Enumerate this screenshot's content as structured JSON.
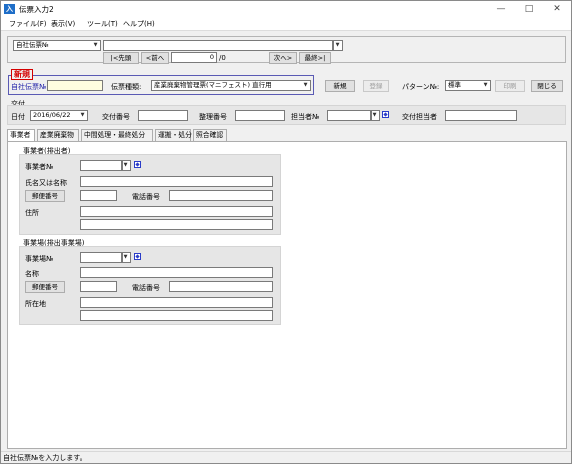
{
  "window": {
    "title": "伝票入力2",
    "icon_text": "入"
  },
  "window_controls": {
    "minimize": "—",
    "maximize": "□",
    "close": "✕"
  },
  "menu": [
    "ファイル(F)",
    "表示(V)",
    "ツール(T)",
    "ヘルプ(H)"
  ],
  "nav": {
    "key_select": "自社伝票№",
    "key_input": "",
    "first": "|<先頭",
    "prev": "<前へ",
    "page_value": "0",
    "page_total": "/0",
    "next": "次へ>",
    "last": "最終>|"
  },
  "header": {
    "new_tag": "新規",
    "slip_no_label": "自社伝票№:",
    "slip_no_value": "",
    "slip_type_label": "伝票種類:",
    "slip_type_value": "産業廃棄物管理票(マニフェスト) 直行用",
    "new_button": "新規",
    "register_button": "登録",
    "pattern_label": "パターン№:",
    "pattern_value": "標準",
    "print_button": "印刷",
    "close_button": "閉じる"
  },
  "issue": {
    "section_label": "交付",
    "date_label": "日付",
    "date_value": "2016/06/22",
    "doc_no_label": "交付番号",
    "doc_no_value": "",
    "ref_no_label": "整理番号",
    "ref_no_value": "",
    "person_no_label": "担当者№",
    "person_no_value": "",
    "issue_person_label": "交付担当者",
    "issue_person_value": ""
  },
  "tabs": [
    "事業者",
    "産業廃棄物",
    "中間処理・最終処分",
    "運搬・処分",
    "照合確認"
  ],
  "emitter": {
    "title": "事業者(排出者)",
    "no_label": "事業者№",
    "name_label": "氏名又は名称",
    "postal_button": "郵便番号",
    "phone_label": "電話番号",
    "address_label": "住所"
  },
  "site": {
    "title": "事業場(排出事業場)",
    "no_label": "事業場№",
    "name_label": "名称",
    "postal_button": "郵便番号",
    "phone_label": "電話番号",
    "address_label": "所在地"
  },
  "status_bar": "自社伝票№を入力します。"
}
